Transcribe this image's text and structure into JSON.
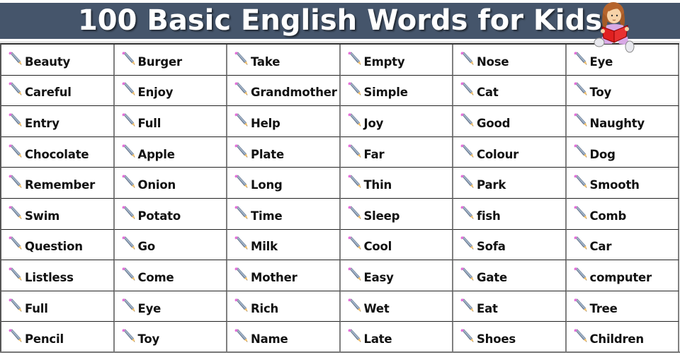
{
  "header": {
    "title": "100 Basic English Words for Kids",
    "banner_color": "#45556b",
    "title_color": "#ffffff"
  },
  "illustration": {
    "icon": "girl-reading-book-icon",
    "description": "girl reading a red book"
  },
  "grid": {
    "columns": 6,
    "rows": 10,
    "item_icon": "pencil-icon",
    "words": [
      [
        "Beauty",
        "Burger",
        "Take",
        "Empty",
        "Nose",
        "Eye"
      ],
      [
        "Careful",
        "Enjoy",
        "Grandmother",
        "Simple",
        "Cat",
        "Toy"
      ],
      [
        "Entry",
        "Full",
        "Help",
        "Joy",
        "Good",
        "Naughty"
      ],
      [
        "Chocolate",
        "Apple",
        "Plate",
        "Far",
        "Colour",
        "Dog"
      ],
      [
        "Remember",
        "Onion",
        "Long",
        "Thin",
        "Park",
        "Smooth"
      ],
      [
        "Swim",
        "Potato",
        "Time",
        "Sleep",
        "fish",
        "Comb"
      ],
      [
        "Question",
        "Go",
        "Milk",
        "Cool",
        "Sofa",
        "Car"
      ],
      [
        "Listless",
        "Come",
        "Mother",
        "Easy",
        "Gate",
        "computer"
      ],
      [
        "Full",
        "Eye",
        "Rich",
        "Wet",
        "Eat",
        "Tree"
      ],
      [
        "Pencil",
        "Toy",
        "Name",
        "Late",
        "Shoes",
        "Children"
      ]
    ]
  }
}
